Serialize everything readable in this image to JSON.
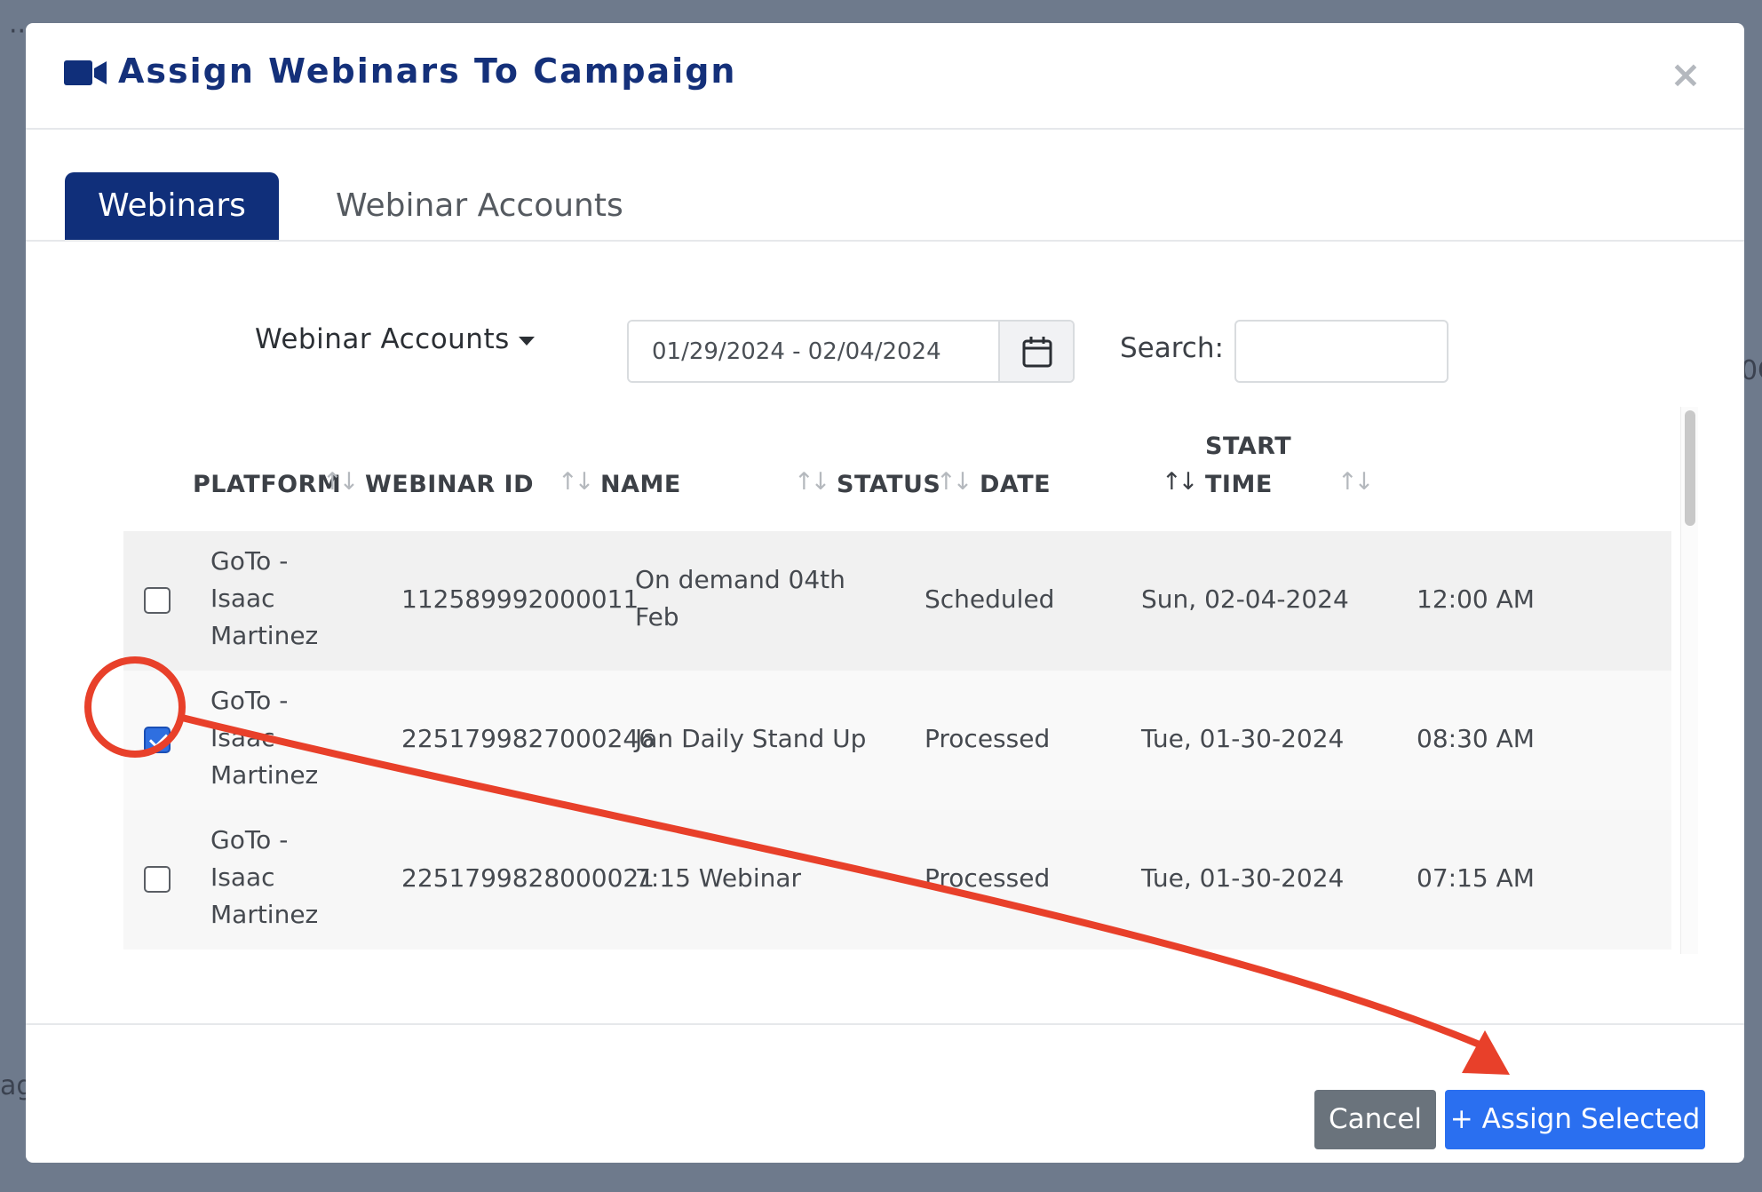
{
  "backdrop": {
    "left_glyph": "··",
    "right_glyph": "0C",
    "bottom_glyph": "ag"
  },
  "modal": {
    "title": "Assign Webinars To Campaign",
    "title_icon": "video-camera-icon",
    "close_label": "×"
  },
  "tabs": [
    {
      "label": "Webinars",
      "active": true
    },
    {
      "label": "Webinar Accounts",
      "active": false
    }
  ],
  "filters": {
    "accounts_dropdown_label": "Webinar Accounts",
    "date_range_value": "01/29/2024 - 02/04/2024",
    "calendar_icon": "calendar-icon",
    "search_label": "Search:",
    "search_value": ""
  },
  "table": {
    "columns": [
      {
        "label": "PLATFORM",
        "sort": "none"
      },
      {
        "label": "WEBINAR ID",
        "sort": "none"
      },
      {
        "label": "NAME",
        "sort": "none"
      },
      {
        "label": "STATUS",
        "sort": "none"
      },
      {
        "label": "DATE",
        "sort": "desc"
      },
      {
        "label": "START",
        "label2": "TIME",
        "sort": "none"
      }
    ],
    "sort_glyph": "↑↓",
    "rows": [
      {
        "checked": false,
        "platform_line1": "GoTo -",
        "platform_line2": "Isaac",
        "platform_line3": "Martinez",
        "webinar_id": "112589992000011",
        "name_line1": "On demand 04th",
        "name_line2": "Feb",
        "status": "Scheduled",
        "date": "Sun, 02-04-2024",
        "start_time": "12:00 AM"
      },
      {
        "checked": true,
        "platform_line1": "GoTo -",
        "platform_line2": "Isaac",
        "platform_line3": "Martinez",
        "webinar_id": "2251799827000246",
        "name_line1": "Jan Daily Stand Up",
        "name_line2": "",
        "status": "Processed",
        "date": "Tue, 01-30-2024",
        "start_time": "08:30 AM"
      },
      {
        "checked": false,
        "platform_line1": "GoTo -",
        "platform_line2": "Isaac",
        "platform_line3": "Martinez",
        "webinar_id": "2251799828000021",
        "name_line1": "7:15 Webinar",
        "name_line2": "",
        "status": "Processed",
        "date": "Tue, 01-30-2024",
        "start_time": "07:15 AM"
      }
    ]
  },
  "footer": {
    "cancel_label": "Cancel",
    "assign_label": "+ Assign Selected"
  },
  "colors": {
    "brand_navy": "#102f7a",
    "primary_blue": "#2a6ff0",
    "cancel_gray": "#6a737c",
    "annotation_red": "#e8402a"
  }
}
